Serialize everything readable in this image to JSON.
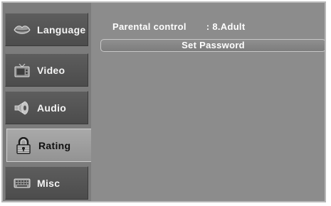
{
  "sidebar": {
    "items": [
      {
        "label": "Language",
        "icon": "lips-icon",
        "active": false
      },
      {
        "label": "Video",
        "icon": "tv-icon",
        "active": false
      },
      {
        "label": "Audio",
        "icon": "speaker-icon",
        "active": false
      },
      {
        "label": "Rating",
        "icon": "lock-icon",
        "active": true
      },
      {
        "label": "Misc",
        "icon": "keyboard-icon",
        "active": false
      }
    ]
  },
  "main": {
    "parental_control_label": "Parental control",
    "parental_control_value": ": 8.Adult",
    "set_password_label": "Set Password"
  },
  "colors": {
    "panel": "#8c8c8c",
    "tab_inactive": "#555555",
    "tab_active": "#a0a0a0"
  }
}
